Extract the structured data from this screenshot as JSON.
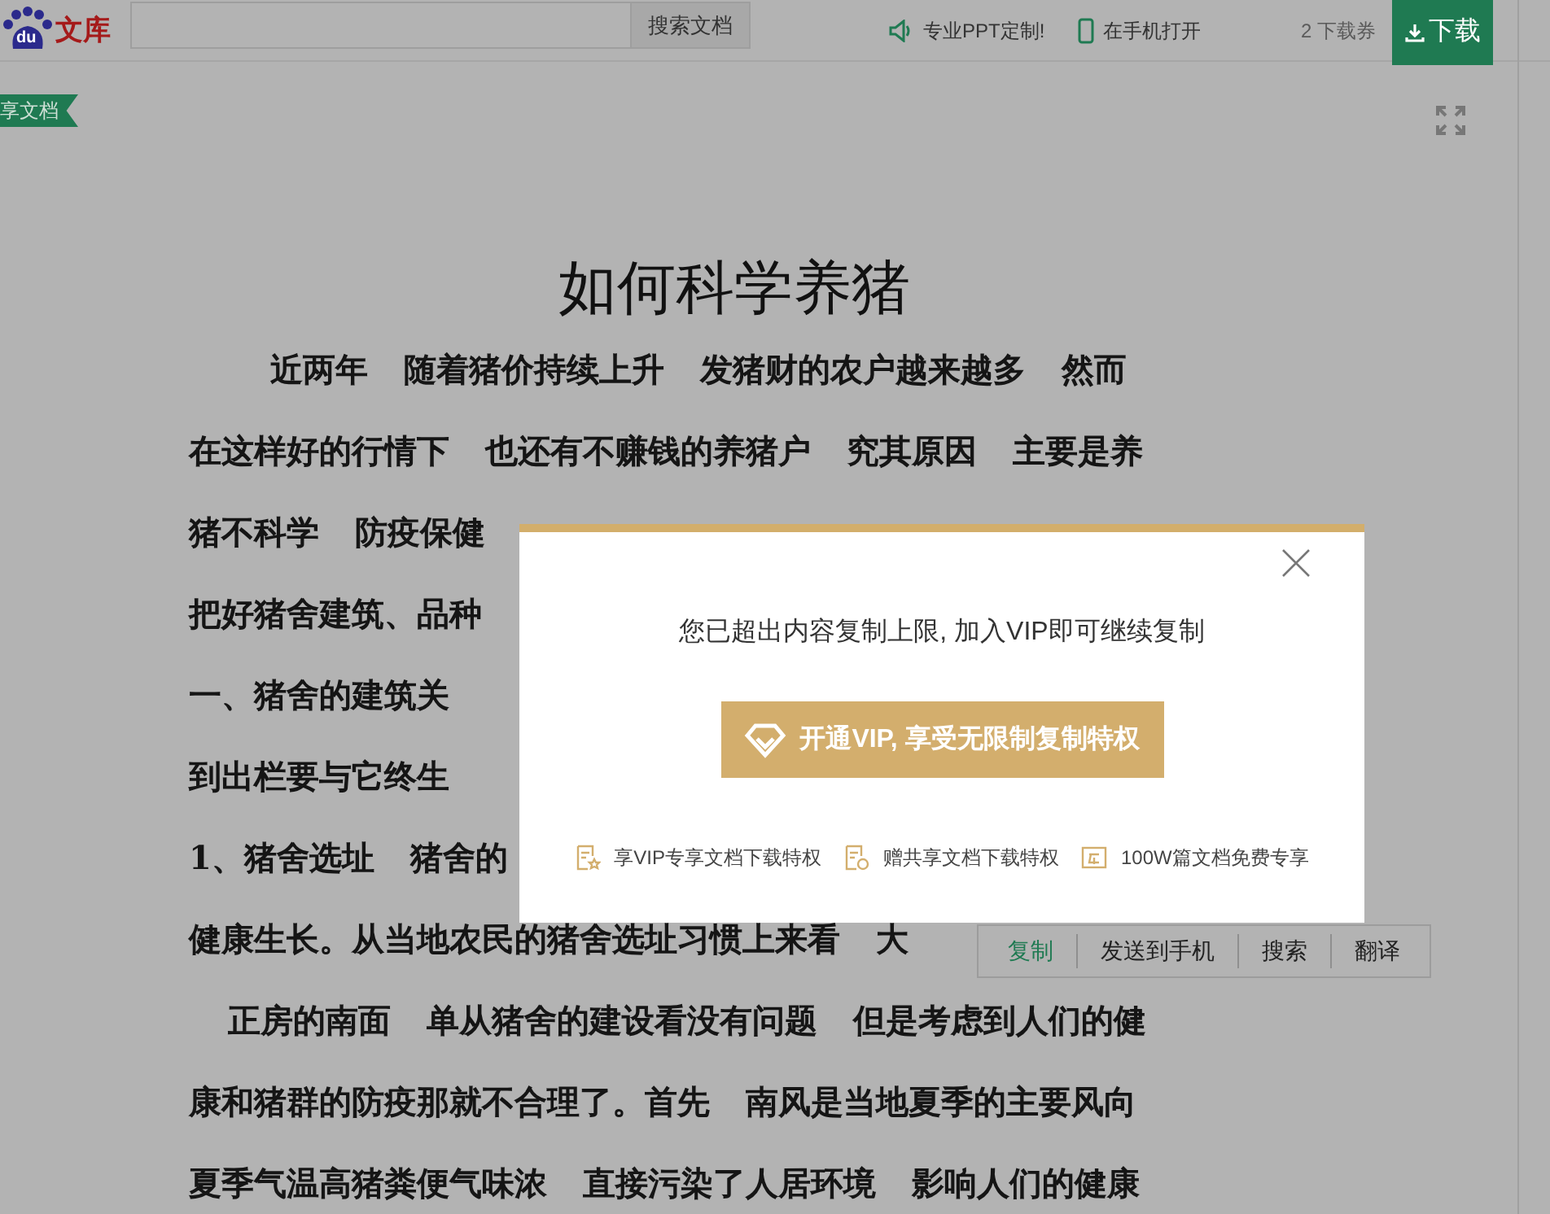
{
  "header": {
    "logo": {
      "badge": "du",
      "text": "文库"
    },
    "search": {
      "button": "搜索文档"
    },
    "links": [
      {
        "kind": "speaker",
        "label": "专业PPT定制!"
      },
      {
        "kind": "phone",
        "label": "在手机打开"
      }
    ],
    "coupons": "2 下载券",
    "download_button": "下载"
  },
  "doc_tag": "享文档",
  "document": {
    "title": "如何科学养猪",
    "lines": [
      {
        "indent": true,
        "segments": [
          "近两年",
          "随着猪价持续上升",
          "发猪财的农户越来越多",
          "然而"
        ]
      },
      {
        "indent": false,
        "segments": [
          "在这样好的行情下",
          "也还有不赚钱的养猪户",
          "究其原因",
          "主要是养"
        ]
      },
      {
        "indent": false,
        "segments": [
          "猪不科学",
          "防疫保健"
        ]
      },
      {
        "indent": false,
        "segments": [
          "把好猪舍建筑、品种"
        ]
      },
      {
        "indent": false,
        "segments": [
          "一、猪舍的建筑关"
        ]
      },
      {
        "indent": false,
        "segments": [
          "到出栏要与它终生"
        ]
      },
      {
        "indent": false,
        "segments": [
          "1、猪舍选址",
          "猪舍的"
        ]
      },
      {
        "indent": false,
        "segments": [
          "健康生长。从当地农民的猪舍选址习惯上来看",
          "大"
        ]
      },
      {
        "indent": true,
        "segments": [
          "正房的南面",
          "单从猪舍的建设看没有问题",
          "但是考虑到人们的健"
        ]
      },
      {
        "indent": false,
        "segments": [
          "康和猪群的防疫那就不合理了。首先",
          "南风是当地夏季的主要风向"
        ]
      },
      {
        "indent": false,
        "segments": [
          "夏季气温高猪粪便气味浓",
          "直接污染了人居环境",
          "影响人们的健康"
        ]
      }
    ]
  },
  "context_menu": [
    {
      "label": "复制",
      "selected": true
    },
    {
      "label": "发送到手机",
      "selected": false
    },
    {
      "label": "搜索",
      "selected": false
    },
    {
      "label": "翻译",
      "selected": false
    }
  ],
  "modal": {
    "message": "您已超出内容复制上限, 加入VIP即可继续复制",
    "vip_button": "开通VIP, 享受无限制复制特权",
    "perks": [
      {
        "kind": "star-doc",
        "label": "享VIP专享文档下载特权"
      },
      {
        "kind": "share-doc",
        "label": "赠共享文档下载特权"
      },
      {
        "kind": "free",
        "label": "100W篇文档免费专享"
      }
    ]
  }
}
